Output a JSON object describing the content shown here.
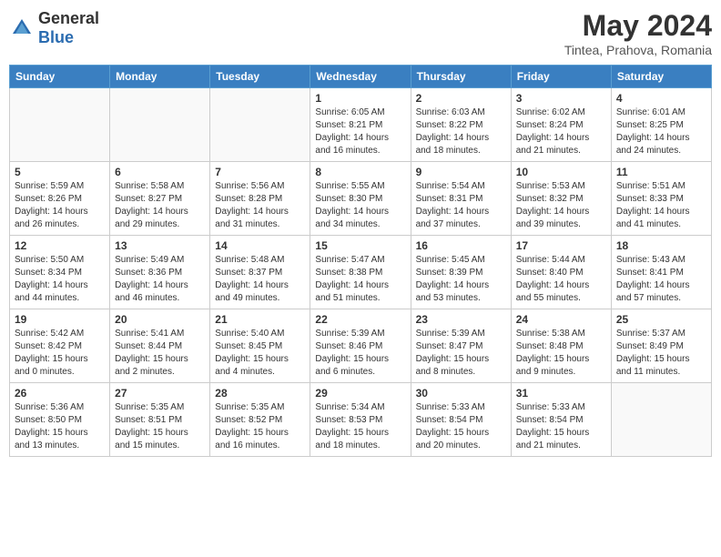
{
  "logo": {
    "general": "General",
    "blue": "Blue"
  },
  "header": {
    "month": "May 2024",
    "location": "Tintea, Prahova, Romania"
  },
  "weekdays": [
    "Sunday",
    "Monday",
    "Tuesday",
    "Wednesday",
    "Thursday",
    "Friday",
    "Saturday"
  ],
  "weeks": [
    [
      {
        "day": "",
        "empty": true
      },
      {
        "day": "",
        "empty": true
      },
      {
        "day": "",
        "empty": true
      },
      {
        "day": "1",
        "sunrise": "6:05 AM",
        "sunset": "8:21 PM",
        "daylight": "14 hours and 16 minutes."
      },
      {
        "day": "2",
        "sunrise": "6:03 AM",
        "sunset": "8:22 PM",
        "daylight": "14 hours and 18 minutes."
      },
      {
        "day": "3",
        "sunrise": "6:02 AM",
        "sunset": "8:24 PM",
        "daylight": "14 hours and 21 minutes."
      },
      {
        "day": "4",
        "sunrise": "6:01 AM",
        "sunset": "8:25 PM",
        "daylight": "14 hours and 24 minutes."
      }
    ],
    [
      {
        "day": "5",
        "sunrise": "5:59 AM",
        "sunset": "8:26 PM",
        "daylight": "14 hours and 26 minutes."
      },
      {
        "day": "6",
        "sunrise": "5:58 AM",
        "sunset": "8:27 PM",
        "daylight": "14 hours and 29 minutes."
      },
      {
        "day": "7",
        "sunrise": "5:56 AM",
        "sunset": "8:28 PM",
        "daylight": "14 hours and 31 minutes."
      },
      {
        "day": "8",
        "sunrise": "5:55 AM",
        "sunset": "8:30 PM",
        "daylight": "14 hours and 34 minutes."
      },
      {
        "day": "9",
        "sunrise": "5:54 AM",
        "sunset": "8:31 PM",
        "daylight": "14 hours and 37 minutes."
      },
      {
        "day": "10",
        "sunrise": "5:53 AM",
        "sunset": "8:32 PM",
        "daylight": "14 hours and 39 minutes."
      },
      {
        "day": "11",
        "sunrise": "5:51 AM",
        "sunset": "8:33 PM",
        "daylight": "14 hours and 41 minutes."
      }
    ],
    [
      {
        "day": "12",
        "sunrise": "5:50 AM",
        "sunset": "8:34 PM",
        "daylight": "14 hours and 44 minutes."
      },
      {
        "day": "13",
        "sunrise": "5:49 AM",
        "sunset": "8:36 PM",
        "daylight": "14 hours and 46 minutes."
      },
      {
        "day": "14",
        "sunrise": "5:48 AM",
        "sunset": "8:37 PM",
        "daylight": "14 hours and 49 minutes."
      },
      {
        "day": "15",
        "sunrise": "5:47 AM",
        "sunset": "8:38 PM",
        "daylight": "14 hours and 51 minutes."
      },
      {
        "day": "16",
        "sunrise": "5:45 AM",
        "sunset": "8:39 PM",
        "daylight": "14 hours and 53 minutes."
      },
      {
        "day": "17",
        "sunrise": "5:44 AM",
        "sunset": "8:40 PM",
        "daylight": "14 hours and 55 minutes."
      },
      {
        "day": "18",
        "sunrise": "5:43 AM",
        "sunset": "8:41 PM",
        "daylight": "14 hours and 57 minutes."
      }
    ],
    [
      {
        "day": "19",
        "sunrise": "5:42 AM",
        "sunset": "8:42 PM",
        "daylight": "15 hours and 0 minutes."
      },
      {
        "day": "20",
        "sunrise": "5:41 AM",
        "sunset": "8:44 PM",
        "daylight": "15 hours and 2 minutes."
      },
      {
        "day": "21",
        "sunrise": "5:40 AM",
        "sunset": "8:45 PM",
        "daylight": "15 hours and 4 minutes."
      },
      {
        "day": "22",
        "sunrise": "5:39 AM",
        "sunset": "8:46 PM",
        "daylight": "15 hours and 6 minutes."
      },
      {
        "day": "23",
        "sunrise": "5:39 AM",
        "sunset": "8:47 PM",
        "daylight": "15 hours and 8 minutes."
      },
      {
        "day": "24",
        "sunrise": "5:38 AM",
        "sunset": "8:48 PM",
        "daylight": "15 hours and 9 minutes."
      },
      {
        "day": "25",
        "sunrise": "5:37 AM",
        "sunset": "8:49 PM",
        "daylight": "15 hours and 11 minutes."
      }
    ],
    [
      {
        "day": "26",
        "sunrise": "5:36 AM",
        "sunset": "8:50 PM",
        "daylight": "15 hours and 13 minutes."
      },
      {
        "day": "27",
        "sunrise": "5:35 AM",
        "sunset": "8:51 PM",
        "daylight": "15 hours and 15 minutes."
      },
      {
        "day": "28",
        "sunrise": "5:35 AM",
        "sunset": "8:52 PM",
        "daylight": "15 hours and 16 minutes."
      },
      {
        "day": "29",
        "sunrise": "5:34 AM",
        "sunset": "8:53 PM",
        "daylight": "15 hours and 18 minutes."
      },
      {
        "day": "30",
        "sunrise": "5:33 AM",
        "sunset": "8:54 PM",
        "daylight": "15 hours and 20 minutes."
      },
      {
        "day": "31",
        "sunrise": "5:33 AM",
        "sunset": "8:54 PM",
        "daylight": "15 hours and 21 minutes."
      },
      {
        "day": "",
        "empty": true
      }
    ]
  ]
}
